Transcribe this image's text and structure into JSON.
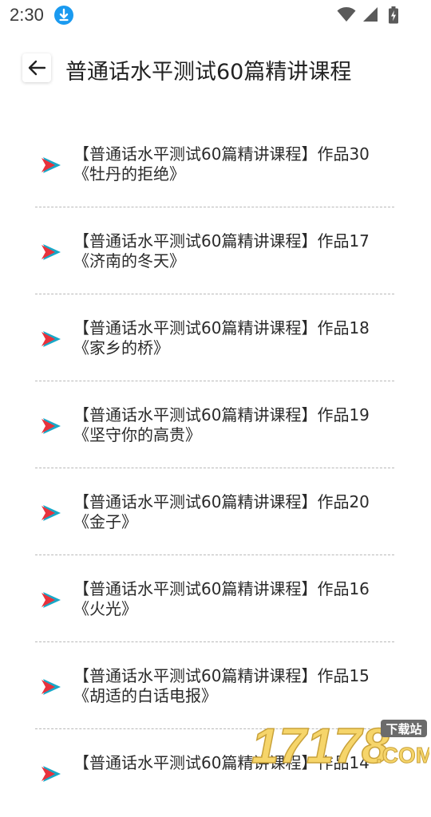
{
  "status": {
    "time": "2:30"
  },
  "header": {
    "title": "普通话水平测试60篇精讲课程"
  },
  "items": [
    {
      "title": "【普通话水平测试60篇精讲课程】作品30",
      "subtitle": "《牡丹的拒绝》"
    },
    {
      "title": "【普通话水平测试60篇精讲课程】作品17",
      "subtitle": "《济南的冬天》"
    },
    {
      "title": "【普通话水平测试60篇精讲课程】作品18",
      "subtitle": "《家乡的桥》"
    },
    {
      "title": "【普通话水平测试60篇精讲课程】作品19",
      "subtitle": "《坚守你的高贵》"
    },
    {
      "title": "【普通话水平测试60篇精讲课程】作品20",
      "subtitle": "《金子》"
    },
    {
      "title": "【普通话水平测试60篇精讲课程】作品16",
      "subtitle": "《火光》"
    },
    {
      "title": "【普通话水平测试60篇精讲课程】作品15",
      "subtitle": "《胡适的白话电报》"
    },
    {
      "title": "【普通话水平测试60篇精讲课程】作品14",
      "subtitle": ""
    }
  ],
  "watermark": {
    "number": "17178",
    "tag": "下载站",
    "domain": ".COM"
  },
  "colors": {
    "accent_blue": "#1a9af0",
    "play_red": "#e8323c",
    "play_teal": "#18a8c8"
  },
  "icons": {
    "back": "arrow-left-icon",
    "download": "download-icon",
    "wifi": "wifi-icon",
    "signal": "signal-icon",
    "battery": "battery-icon",
    "play": "play-icon"
  }
}
